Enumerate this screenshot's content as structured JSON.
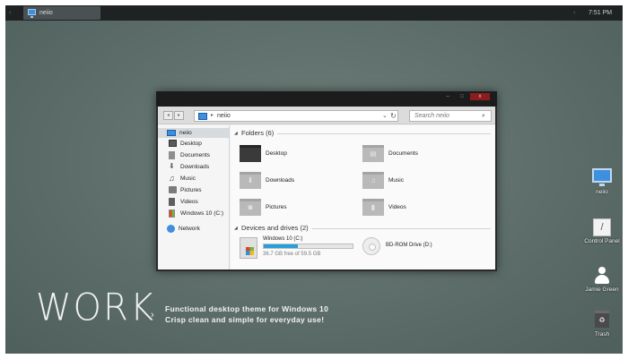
{
  "taskbar": {
    "left_arrow": "‹",
    "task_label": "neiio",
    "right_arrow": "‹",
    "clock": "7:51 PM"
  },
  "window": {
    "controls": {
      "minimize": "–",
      "maximize": "□",
      "close": "x"
    },
    "address": {
      "back": "◂",
      "forward": "▸",
      "separator": "▸",
      "path": "neiio",
      "dropdown": "⌄",
      "refresh": "↻"
    },
    "search": {
      "placeholder": "Search neiio",
      "icon": "⌕"
    },
    "nav_pane": {
      "root": "neiio",
      "items": [
        {
          "label": "Desktop",
          "icon": "desktop-icon"
        },
        {
          "label": "Documents",
          "icon": "documents-icon"
        },
        {
          "label": "Downloads",
          "icon": "downloads-icon"
        },
        {
          "label": "Music",
          "icon": "music-icon"
        },
        {
          "label": "Pictures",
          "icon": "pictures-icon"
        },
        {
          "label": "Videos",
          "icon": "videos-icon"
        },
        {
          "label": "Windows 10 (C:)",
          "icon": "drive-icon"
        }
      ],
      "network": "Network"
    },
    "folders": {
      "header": "Folders (6)",
      "items": [
        {
          "label": "Desktop",
          "glyph": ""
        },
        {
          "label": "Documents",
          "glyph": "▤"
        },
        {
          "label": "Downloads",
          "glyph": "⬇"
        },
        {
          "label": "Music",
          "glyph": "♫"
        },
        {
          "label": "Pictures",
          "glyph": "◙"
        },
        {
          "label": "Videos",
          "glyph": "▮"
        }
      ]
    },
    "drives": {
      "header": "Devices and drives (2)",
      "items": [
        {
          "label": "Windows 10 (C:)",
          "free_text": "36.7 GB free of 59.5 GB",
          "used_fraction": 0.38
        },
        {
          "label": "BD-ROM Drive (D:)"
        }
      ]
    }
  },
  "desktop_icons": [
    {
      "label": "neiio",
      "icon": "computer-icon"
    },
    {
      "label": "Control Panel",
      "icon": "control-panel-icon"
    },
    {
      "label": "Jamie Green",
      "icon": "user-icon"
    },
    {
      "label": "Trash",
      "icon": "trash-icon"
    }
  ],
  "slogan": {
    "title": "WORK",
    "chevron": "›",
    "line1": "Functional desktop theme for Windows 10",
    "line2": "Crisp clean and simple for everyday use!"
  },
  "colors": {
    "desktop": "#5d6e6a",
    "taskbar": "#1f2223",
    "accent": "#3d8fe0",
    "drive_bar": "#26a0da",
    "close": "#8c1d1d"
  }
}
